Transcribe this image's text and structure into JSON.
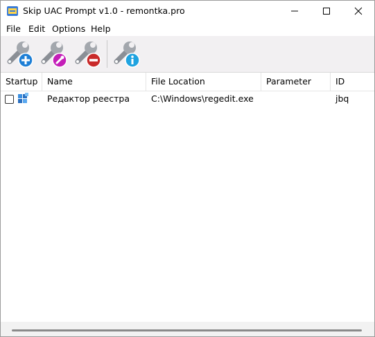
{
  "window": {
    "title": "Skip UAC Prompt v1.0 - remontka.pro"
  },
  "caption_buttons": {
    "minimize_icon": "minimize-icon",
    "maximize_icon": "maximize-icon",
    "close_icon": "close-icon"
  },
  "menu": {
    "items": [
      {
        "label": "File"
      },
      {
        "label": "Edit"
      },
      {
        "label": "Options"
      },
      {
        "label": "Help"
      }
    ]
  },
  "toolbar": {
    "buttons": [
      {
        "icon": "add-wrench-icon",
        "accent": "#1e7fd6"
      },
      {
        "icon": "edit-wrench-icon",
        "accent": "#c41fb8"
      },
      {
        "icon": "delete-wrench-icon",
        "accent": "#c92a2a"
      },
      {
        "icon": "info-wrench-icon",
        "accent": "#1fa3e0"
      }
    ]
  },
  "table": {
    "columns": [
      "Startup",
      "Name",
      "File Location",
      "Parameter",
      "ID"
    ],
    "rows": [
      {
        "startup_checked": false,
        "icon": "registry-editor-icon",
        "name": "Редактор реестра",
        "file_location": "C:\\Windows\\regedit.exe",
        "parameter": "",
        "id": "jbq"
      }
    ]
  }
}
